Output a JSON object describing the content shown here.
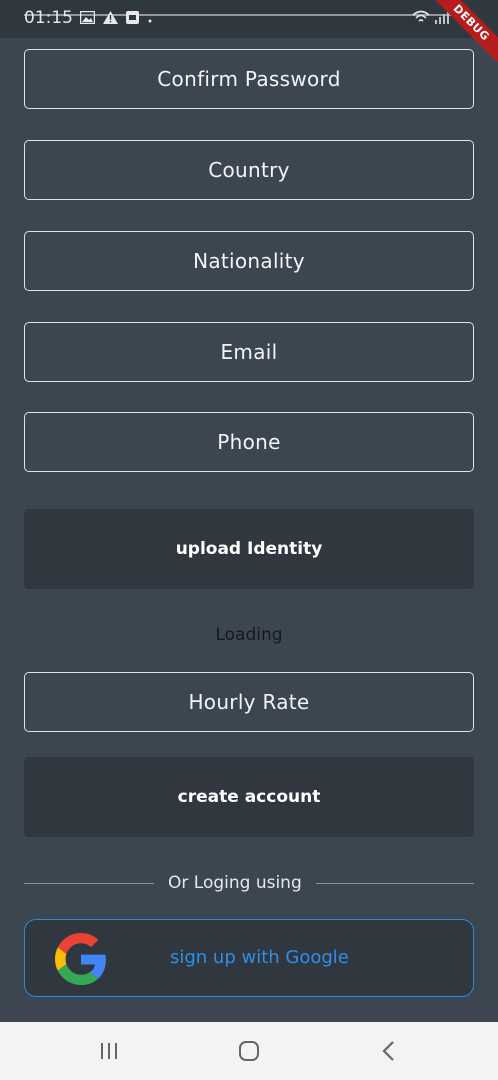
{
  "status_bar": {
    "time": "01:15",
    "debug_label": "DEBUG"
  },
  "form": {
    "confirm_password_placeholder": "Confirm Password",
    "country_placeholder": "Country",
    "nationality_placeholder": "Nationality",
    "email_placeholder": "Email",
    "phone_placeholder": "Phone",
    "upload_identity_label": "upload Identity",
    "loading_text": "Loading",
    "hourly_rate_placeholder": "Hourly Rate",
    "create_account_label": "create account",
    "divider_text": "Or Loging using",
    "google_button_label": "sign up with Google"
  },
  "colors": {
    "background": "#3c4650",
    "button_dark": "#30373f",
    "google_accent": "#2e86de"
  }
}
